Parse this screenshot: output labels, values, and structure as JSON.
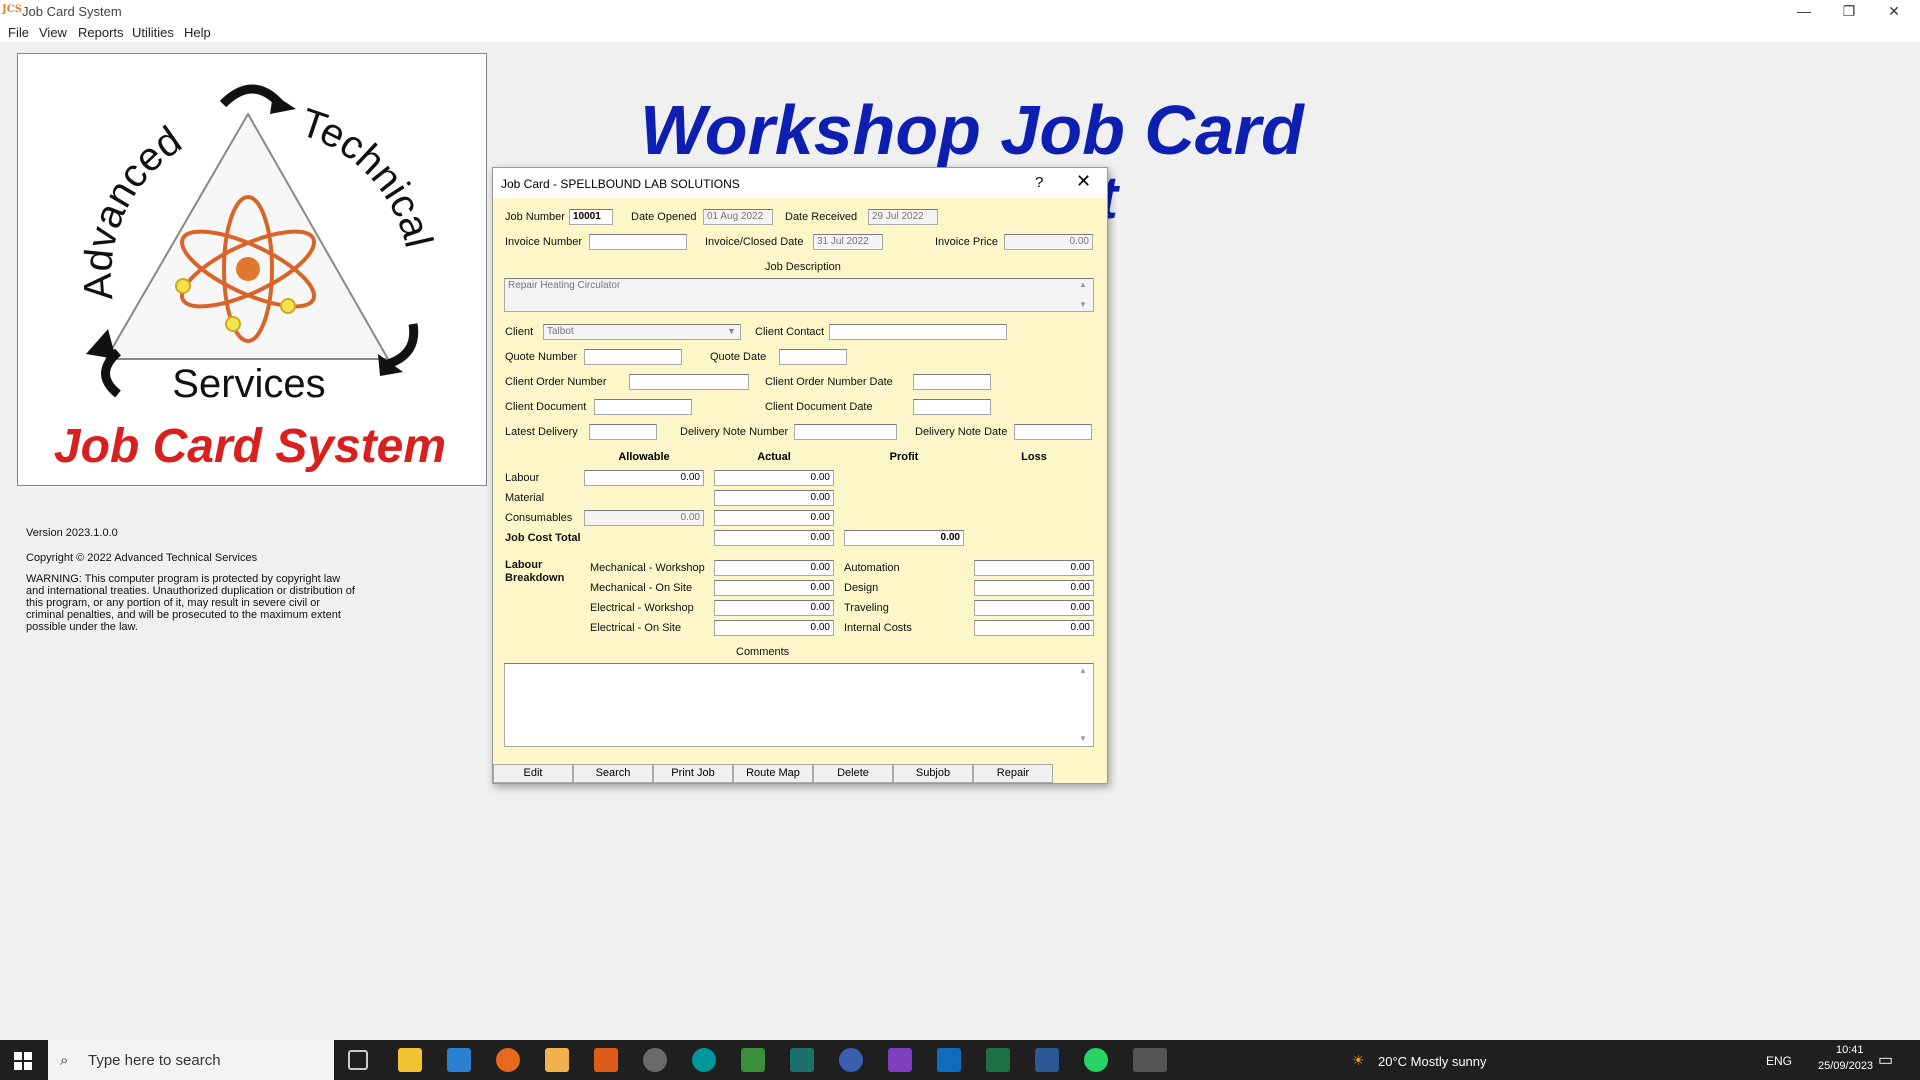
{
  "window": {
    "app_icon_text": "JCS",
    "title": "Job Card System",
    "minimize": "—",
    "restore": "❐",
    "close": "✕"
  },
  "menu": [
    "File",
    "View",
    "Reports",
    "Utilities",
    "Help"
  ],
  "logo": {
    "arc_left": "Advanced",
    "arc_right": "Technical",
    "bottom": "Services",
    "system": "Job Card System"
  },
  "heading": "Workshop Job Card",
  "heading_fragment": "t",
  "info": {
    "version": "Version 2023.1.0.0",
    "copyright": "Copyright ©  2022 Advanced Technical Services",
    "warning": "WARNING: This computer program is protected by copyright law and international treaties. Unauthorized duplication or distribution of this program, or any portion of it, may result in severe civil or criminal penalties, and will be prosecuted to the maximum extent possible under the law."
  },
  "dialog": {
    "title": "Job Card - SPELLBOUND LAB SOLUTIONS",
    "help": "?",
    "close": "✕",
    "labels": {
      "job_number": "Job Number",
      "date_opened": "Date Opened",
      "date_received": "Date Received",
      "invoice_number": "Invoice Number",
      "invoice_closed_date": "Invoice/Closed Date",
      "invoice_price": "Invoice Price",
      "job_description": "Job Description",
      "client": "Client",
      "client_contact": "Client Contact",
      "quote_number": "Quote Number",
      "quote_date": "Quote Date",
      "client_order_number": "Client Order Number",
      "client_order_number_date": "Client Order Number Date",
      "client_document": "Client Document",
      "client_document_date": "Client Document Date",
      "latest_delivery": "Latest Delivery",
      "delivery_note_number": "Delivery Note Number",
      "delivery_note_date": "Delivery Note Date",
      "allowable": "Allowable",
      "actual": "Actual",
      "profit": "Profit",
      "loss": "Loss",
      "labour": "Labour",
      "material": "Material",
      "consumables": "Consumables",
      "job_cost_total": "Job Cost Total",
      "labour_breakdown": "Labour Breakdown",
      "mech_workshop": "Mechanical - Workshop",
      "mech_onsite": "Mechanical - On Site",
      "elec_workshop": "Electrical - Workshop",
      "elec_onsite": "Electrical - On Site",
      "automation": "Automation",
      "design": "Design",
      "traveling": "Traveling",
      "internal_costs": "Internal Costs",
      "comments": "Comments"
    },
    "values": {
      "job_number": "10001",
      "date_opened": "01 Aug 2022",
      "date_received": "29 Jul 2022",
      "invoice_number": "",
      "invoice_closed_date": "31 Jul 2022",
      "invoice_price": "0.00",
      "job_description": "Repair Heating Circulator",
      "client": "Talbot",
      "labour_allowable": "0.00",
      "labour_actual": "0.00",
      "material_actual": "0.00",
      "consumables_allowable": "0.00",
      "consumables_actual": "0.00",
      "job_cost_total_actual": "0.00",
      "job_cost_total_profit": "0.00",
      "mech_workshop": "0.00",
      "mech_onsite": "0.00",
      "elec_workshop": "0.00",
      "elec_onsite": "0.00",
      "automation": "0.00",
      "design": "0.00",
      "traveling": "0.00",
      "internal_costs": "0.00"
    },
    "buttons": [
      "Edit",
      "Search",
      "Print Job",
      "Route Map",
      "Delete",
      "Subjob",
      "Repair"
    ]
  },
  "taskbar": {
    "search_placeholder": "Type here to search",
    "weather": "20°C  Mostly sunny",
    "language": "ENG",
    "time": "10:41",
    "date": "25/09/2023"
  },
  "colors": {
    "dialog_bg": "#fdf6c9",
    "heading": "#0c1fb0",
    "logo_red": "#d8201e"
  }
}
